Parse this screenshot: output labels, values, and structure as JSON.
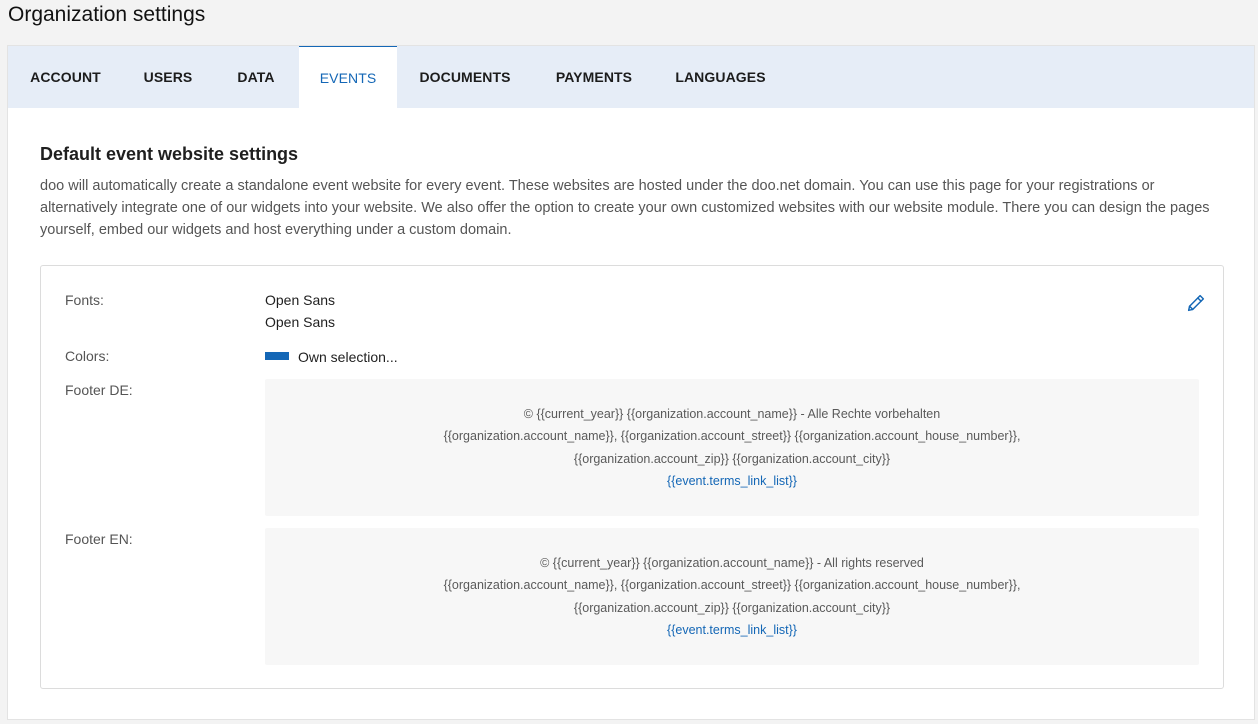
{
  "page": {
    "title": "Organization settings"
  },
  "tabs": [
    {
      "label": "ACCOUNT",
      "active": false
    },
    {
      "label": "USERS",
      "active": false
    },
    {
      "label": "DATA",
      "active": false
    },
    {
      "label": "EVENTS",
      "active": true
    },
    {
      "label": "DOCUMENTS",
      "active": false
    },
    {
      "label": "PAYMENTS",
      "active": false
    },
    {
      "label": "LANGUAGES",
      "active": false
    }
  ],
  "section": {
    "title": "Default event website settings",
    "description": "doo will automatically create a standalone event website for every event. These websites are hosted under the doo.net domain. You can use this page for your registrations or alternatively integrate one of our widgets into your website. We also offer the option to create your own customized websites with our website module. There you can design the pages yourself, embed our widgets and host everything under a custom domain."
  },
  "settings": {
    "fonts_label": "Fonts:",
    "fonts": [
      "Open Sans",
      "Open Sans"
    ],
    "colors_label": "Colors:",
    "colors_value": "Own selection...",
    "color_swatch": "#1467b6",
    "edit_icon": "pencil-icon",
    "footer_de": {
      "label": "Footer DE:",
      "line1": "© {{current_year}} {{organization.account_name}} - Alle Rechte vorbehalten",
      "line2": "{{organization.account_name}}, {{organization.account_street}} {{organization.account_house_number}},",
      "line3": "{{organization.account_zip}} {{organization.account_city}}",
      "link": "{{event.terms_link_list}}"
    },
    "footer_en": {
      "label": "Footer EN:",
      "line1": "© {{current_year}} {{organization.account_name}} - All rights reserved",
      "line2": "{{organization.account_name}}, {{organization.account_street}} {{organization.account_house_number}},",
      "line3": "{{organization.account_zip}} {{organization.account_city}}",
      "link": "{{event.terms_link_list}}"
    }
  },
  "colors": {
    "accent": "#1467b6",
    "tabbar_bg": "#e6edf7"
  }
}
